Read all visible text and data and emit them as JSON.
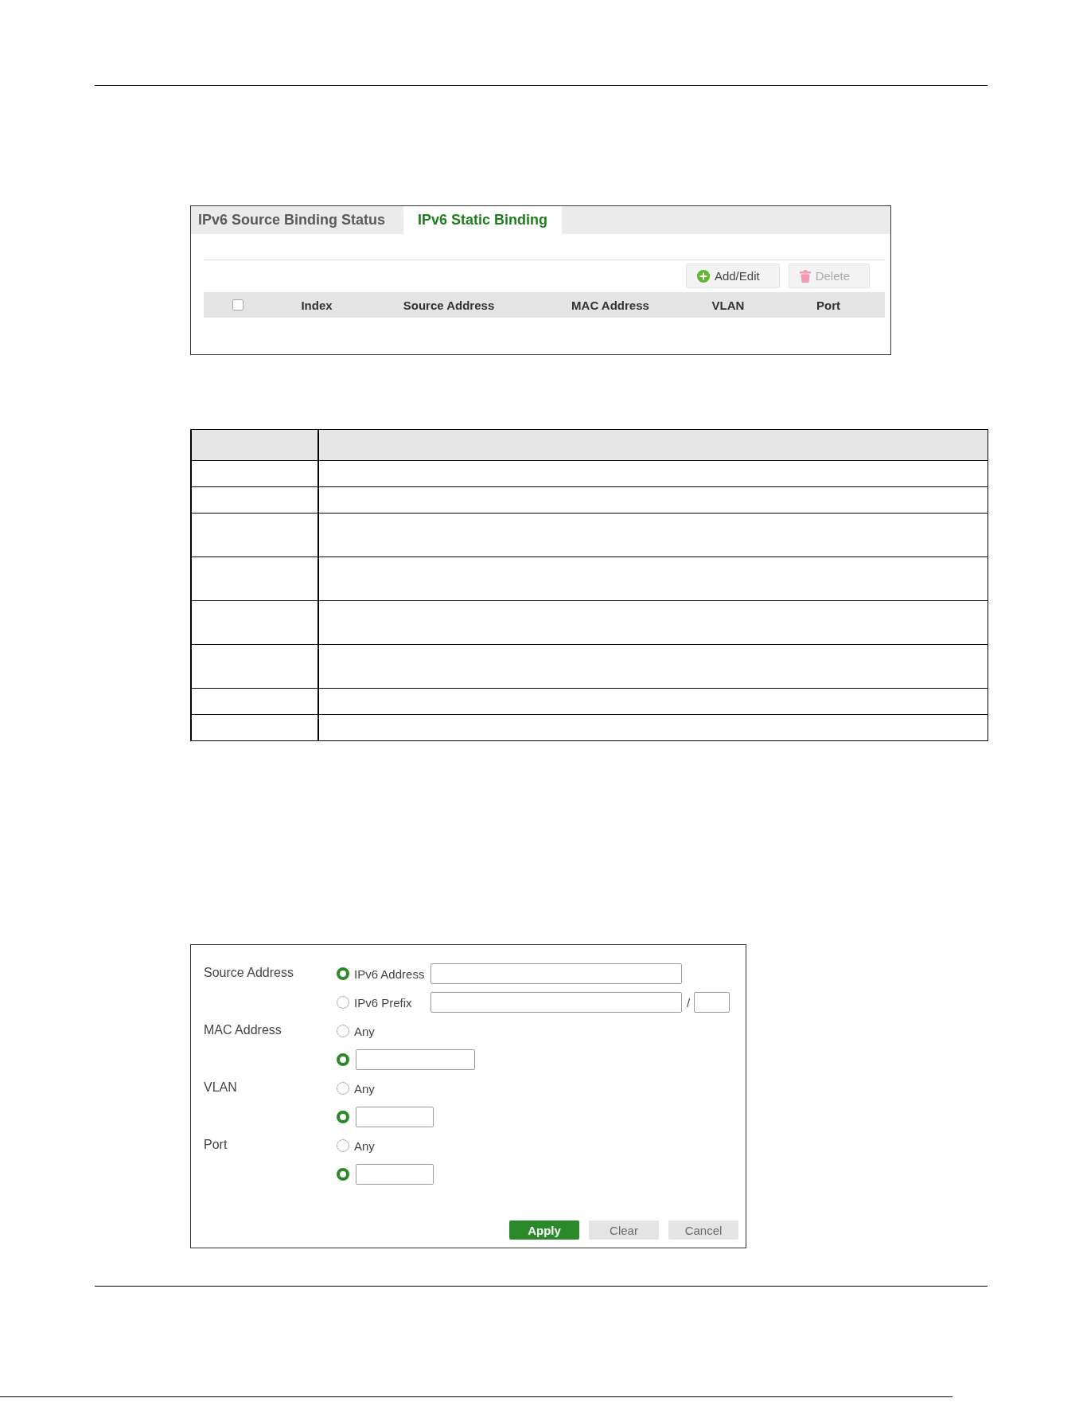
{
  "tabs": [
    {
      "label": "IPv6 Source Binding Status",
      "selected": false
    },
    {
      "label": "IPv6 Static Binding",
      "selected": true
    }
  ],
  "toolbar": [
    {
      "kind": "add",
      "label": "Add/Edit",
      "disabled": false
    },
    {
      "kind": "delete",
      "label": "Delete",
      "disabled": true
    }
  ],
  "binding_table": {
    "select_all_checked": false,
    "columns": [
      "Index",
      "Source Address",
      "MAC Address",
      "VLAN",
      "Port"
    ]
  },
  "form": {
    "fields": [
      {
        "label": "Source Address",
        "options": [
          {
            "kind": "address",
            "label": "IPv6 Address",
            "selected": true
          },
          {
            "kind": "prefix",
            "label": "IPv6 Prefix",
            "separator": "/",
            "selected": false
          }
        ]
      },
      {
        "label": "MAC Address",
        "options": [
          {
            "kind": "any",
            "label": "Any",
            "selected": false
          },
          {
            "kind": "mac",
            "selected": true
          }
        ]
      },
      {
        "label": "VLAN",
        "options": [
          {
            "kind": "any",
            "label": "Any",
            "selected": false
          },
          {
            "kind": "number",
            "selected": true
          }
        ]
      },
      {
        "label": "Port",
        "options": [
          {
            "kind": "any",
            "label": "Any",
            "selected": false
          },
          {
            "kind": "number",
            "selected": true
          }
        ]
      }
    ],
    "buttons": [
      {
        "kind": "apply",
        "label": "Apply"
      },
      {
        "kind": "clear",
        "label": "Clear"
      },
      {
        "kind": "cancel",
        "label": "Cancel"
      }
    ]
  }
}
